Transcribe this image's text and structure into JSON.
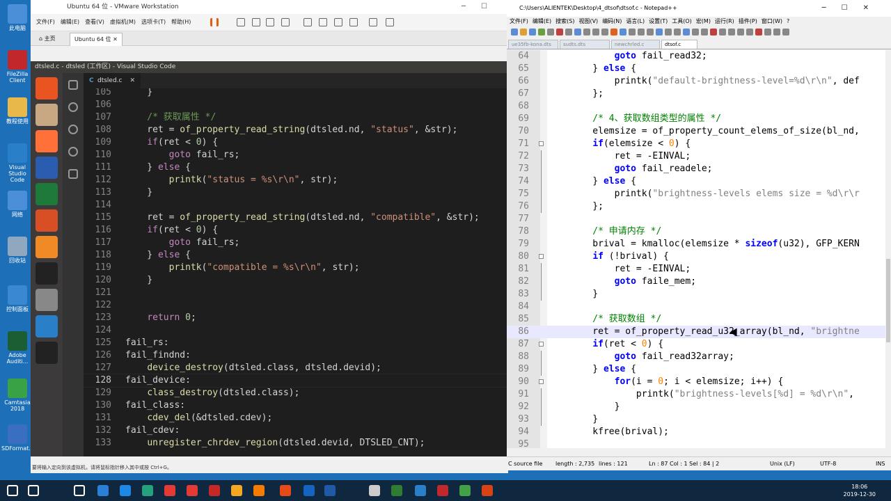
{
  "desktop": {
    "icons": [
      {
        "label": "此电脑",
        "color": "#4a8fd8"
      },
      {
        "label": "FileZilla Client",
        "color": "#c0282c"
      },
      {
        "label": "教程使用",
        "color": "#e8b84a"
      },
      {
        "label": "Visual Studio Code",
        "color": "#2a7fc9"
      },
      {
        "label": "网络",
        "color": "#4a8fd8"
      },
      {
        "label": "回收站",
        "color": "#8fa8c0"
      },
      {
        "label": "控制面板",
        "color": "#3a88d0"
      },
      {
        "label": "Adobe Auditi...",
        "color": "#1b5e34"
      },
      {
        "label": "Camtasia 2018",
        "color": "#39a244"
      },
      {
        "label": "SDFormat...",
        "color": "#3a6fbf"
      }
    ]
  },
  "vmware": {
    "title": "Ubuntu 64 位 - VMware Workstation",
    "menu": [
      "文件(F)",
      "编辑(E)",
      "查看(V)",
      "虚拟机(M)",
      "选项卡(T)",
      "帮助(H)"
    ],
    "tabs": [
      "主页",
      "Ubuntu 64 位"
    ],
    "status_text": "要将输入定向到该虚拟机，请将鼠标指针移入其中或按 Ctrl+G。"
  },
  "ubuntu": {
    "top_bar_title": "dtsled.c - dtsled (工作区) - Visual Studio Code",
    "launcher_colors": [
      "#e95420",
      "#c8a882",
      "#ff7139",
      "#2a5db0",
      "#1d7a3a",
      "#d94f25",
      "#f08a24",
      "#222222",
      "#888888",
      "#2a7fc9",
      "#222222"
    ]
  },
  "vscode": {
    "tab_label": "dtsled.c",
    "cursor_line": "128",
    "lines": [
      {
        "n": "105",
        "t": "    }"
      },
      {
        "n": "106",
        "t": ""
      },
      {
        "n": "107",
        "t": "    /* 获取属性 */"
      },
      {
        "n": "108",
        "t": "    ret = of_property_read_string(dtsled.nd, \"status\", &str);"
      },
      {
        "n": "109",
        "t": "    if(ret < 0) {"
      },
      {
        "n": "110",
        "t": "        goto fail_rs;"
      },
      {
        "n": "111",
        "t": "    } else {"
      },
      {
        "n": "112",
        "t": "        printk(\"status = %s\\r\\n\", str);"
      },
      {
        "n": "113",
        "t": "    }"
      },
      {
        "n": "114",
        "t": ""
      },
      {
        "n": "115",
        "t": "    ret = of_property_read_string(dtsled.nd, \"compatible\", &str);"
      },
      {
        "n": "116",
        "t": "    if(ret < 0) {"
      },
      {
        "n": "117",
        "t": "        goto fail_rs;"
      },
      {
        "n": "118",
        "t": "    } else {"
      },
      {
        "n": "119",
        "t": "        printk(\"compatible = %s\\r\\n\", str);"
      },
      {
        "n": "120",
        "t": "    }"
      },
      {
        "n": "121",
        "t": ""
      },
      {
        "n": "122",
        "t": ""
      },
      {
        "n": "123",
        "t": "    return 0;"
      },
      {
        "n": "124",
        "t": ""
      },
      {
        "n": "125",
        "t": "fail_rs:"
      },
      {
        "n": "126",
        "t": "fail_findnd:"
      },
      {
        "n": "127",
        "t": "    device_destroy(dtsled.class, dtsled.devid);"
      },
      {
        "n": "128",
        "t": "fail_device:"
      },
      {
        "n": "129",
        "t": "    class_destroy(dtsled.class);"
      },
      {
        "n": "130",
        "t": "fail_class:"
      },
      {
        "n": "131",
        "t": "    cdev_del(&dtsled.cdev);"
      },
      {
        "n": "132",
        "t": "fail_cdev:"
      },
      {
        "n": "133",
        "t": "    unregister_chrdev_region(dtsled.devid, DTSLED_CNT);"
      }
    ]
  },
  "notepad": {
    "title": "C:\\Users\\ALIENTEK\\Desktop\\4_dtsof\\dtsof.c - Notepad++",
    "menu": [
      "文件(F)",
      "编辑(E)",
      "搜索(S)",
      "视图(V)",
      "编码(N)",
      "语言(L)",
      "设置(T)",
      "工具(O)",
      "宏(M)",
      "运行(R)",
      "插件(P)",
      "窗口(W)",
      "?"
    ],
    "tabs": [
      "ue35fb-kona.dts",
      "sudts.dts",
      "newchrled.c",
      "dtsof.c"
    ],
    "lines": [
      {
        "n": "64",
        "t": "        goto fail_read32;"
      },
      {
        "n": "65",
        "t": "    } else {"
      },
      {
        "n": "66",
        "t": "        printk(\"default-brightness-level=%d\\r\\n\", def"
      },
      {
        "n": "67",
        "t": "    };"
      },
      {
        "n": "68",
        "t": ""
      },
      {
        "n": "69",
        "t": "    /* 4、获取数组类型的属性 */"
      },
      {
        "n": "70",
        "t": "    elemsize = of_property_count_elems_of_size(bl_nd,"
      },
      {
        "n": "71",
        "t": "    if(elemsize < 0) {"
      },
      {
        "n": "72",
        "t": "        ret = -EINVAL;"
      },
      {
        "n": "73",
        "t": "        goto fail_readele;"
      },
      {
        "n": "74",
        "t": "    } else {"
      },
      {
        "n": "75",
        "t": "        printk(\"brightness-levels elems size = %d\\r\\r"
      },
      {
        "n": "76",
        "t": "    };"
      },
      {
        "n": "77",
        "t": ""
      },
      {
        "n": "78",
        "t": "    /* 申请内存 */"
      },
      {
        "n": "79",
        "t": "    brival = kmalloc(elemsize * sizeof(u32), GFP_KERN"
      },
      {
        "n": "80",
        "t": "    if (!brival) {"
      },
      {
        "n": "81",
        "t": "        ret = -EINVAL;"
      },
      {
        "n": "82",
        "t": "        goto faile_mem;"
      },
      {
        "n": "83",
        "t": "    }"
      },
      {
        "n": "84",
        "t": ""
      },
      {
        "n": "85",
        "t": "    /* 获取数组 */"
      },
      {
        "n": "86",
        "t": "    ret = of_property_read_u32_array(bl_nd, \"brightne"
      },
      {
        "n": "87",
        "t": "    if(ret < 0) {"
      },
      {
        "n": "88",
        "t": "        goto fail_read32array;"
      },
      {
        "n": "89",
        "t": "    } else {"
      },
      {
        "n": "90",
        "t": "        for(i = 0; i < elemsize; i++) {"
      },
      {
        "n": "91",
        "t": "            printk(\"brightness-levels[%d] = %d\\r\\n\","
      },
      {
        "n": "92",
        "t": "        }"
      },
      {
        "n": "93",
        "t": "    }"
      },
      {
        "n": "94",
        "t": "    kfree(brival);"
      },
      {
        "n": "95",
        "t": ""
      }
    ],
    "status": {
      "lang": "C source file",
      "length": "length : 2,735",
      "lines": "lines : 121",
      "pos": "Ln : 87    Col : 1    Sel : 84 | 2",
      "eol": "Unix (LF)",
      "enc": "UTF-8",
      "ins": "INS"
    }
  },
  "taskbar": {
    "time": "18:06",
    "date": "2019-12-30",
    "icon_colors": [
      "#ffffff",
      "#ffffff",
      "#ffffff",
      "#2a7fd6",
      "#1e88e5",
      "#26a17b",
      "#e53935",
      "#e53935",
      "#c62828",
      "#f5a623",
      "#f57c00",
      "#e64a19",
      "#1565c0",
      "#1e5aa8",
      "#cccccc",
      "#2e7d32",
      "#2a7fc9",
      "#c0282c",
      "#43a047",
      "#d84315"
    ]
  }
}
